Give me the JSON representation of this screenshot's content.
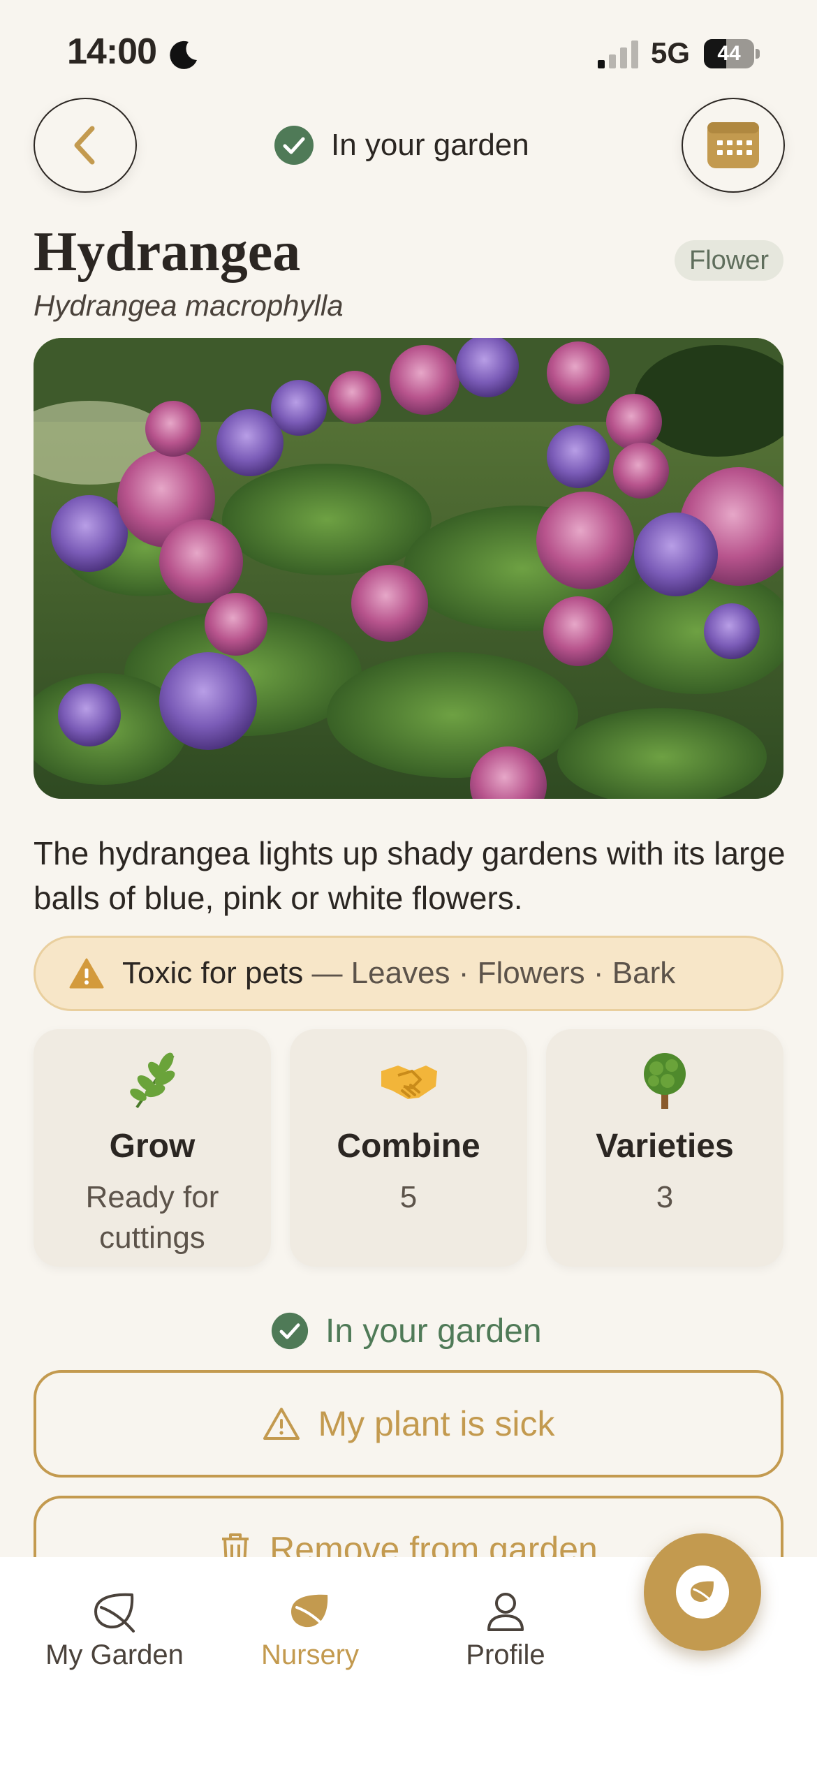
{
  "status_bar": {
    "time": "14:00",
    "network": "5G",
    "battery": "44",
    "battery_level": 0.44
  },
  "header": {
    "status_label": "In your garden",
    "back_icon": "chevron-left-icon",
    "calendar_icon": "calendar-icon"
  },
  "plant": {
    "name": "Hydrangea",
    "latin_name": "Hydrangea macrophylla",
    "category": "Flower",
    "description": "The hydrangea lights up shady gardens with its large balls of blue, pink or white flowers."
  },
  "toxicity": {
    "title": "Toxic for pets",
    "parts": " — Leaves · Flowers · Bark",
    "icon": "warning-icon"
  },
  "cards": [
    {
      "icon": "herb-icon",
      "title": "Grow",
      "value": "Ready for cuttings"
    },
    {
      "icon": "handshake-icon",
      "title": "Combine",
      "value": "5"
    },
    {
      "icon": "tree-icon",
      "title": "Varieties",
      "value": "3"
    }
  ],
  "garden_status": {
    "label": "In your garden"
  },
  "actions": {
    "sick_label": "My plant is sick",
    "remove_label": "Remove from garden"
  },
  "tabbar": {
    "items": [
      {
        "label": "My Garden",
        "icon": "leaf-outline-icon"
      },
      {
        "label": "Nursery",
        "icon": "leaf-filled-icon",
        "active": true
      },
      {
        "label": "Profile",
        "icon": "person-icon"
      }
    ]
  },
  "colors": {
    "background": "#f8f5ef",
    "accent": "#c39a4f",
    "green": "#4f7a57",
    "warning_bg": "#f7e6c8",
    "text": "#2b2622"
  }
}
